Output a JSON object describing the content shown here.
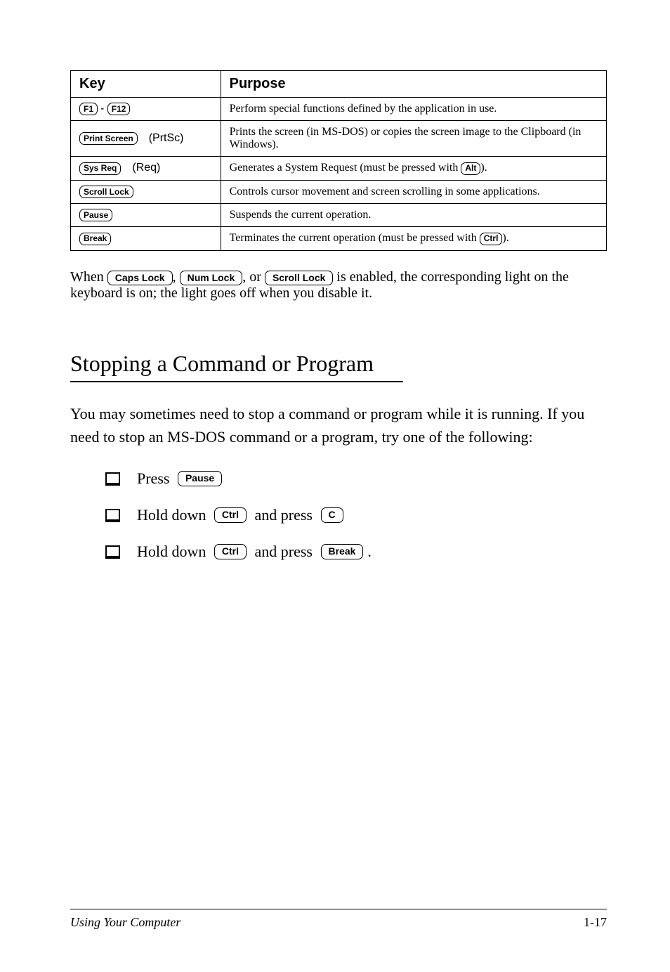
{
  "table": {
    "headers": {
      "key": "Key",
      "purpose": "Purpose"
    },
    "rows": [
      {
        "key_caps": [
          "F1",
          "F12"
        ],
        "key_sep": " - ",
        "key_extra": "",
        "desc": "Perform special functions defined by the application in use."
      },
      {
        "key_caps": [
          "Print Screen"
        ],
        "key_sep": "",
        "key_extra_tail": "(PrtSc)",
        "desc": "Prints the screen (in MS-DOS) or copies the screen image to the Clipboard (in Windows)."
      },
      {
        "key_caps": [
          "Sys Req"
        ],
        "key_sep": "",
        "key_extra_tail": "(Req)",
        "desc_pre": "Generates a System Request (must be pressed with ",
        "desc_cap": "Alt",
        "desc_post": ")."
      },
      {
        "key_caps": [
          "Scroll Lock"
        ],
        "desc": "Controls cursor movement and screen scrolling in some applications."
      },
      {
        "key_caps": [
          "Pause"
        ],
        "desc": "Suspends the current operation."
      },
      {
        "key_caps": [
          "Break"
        ],
        "desc_pre": "Terminates the current operation (must be pressed with ",
        "desc_cap": "Ctrl",
        "desc_post": ")."
      }
    ]
  },
  "note": {
    "pre": "When ",
    "caps": [
      "Caps Lock",
      "Num Lock",
      "Scroll Lock"
    ],
    "mid1": ", ",
    "mid2": ", or ",
    "post": " is enabled, the corresponding light on the keyboard is on; the light goes off when you disable it."
  },
  "section": {
    "title": "Stopping a Command or Program",
    "body": "You may sometimes need to stop a command or program while it is running. If you need to stop an MS-DOS command or a program, try one of the following:",
    "bullets": [
      {
        "pre": "Press ",
        "cap": "Pause",
        "post": ""
      },
      {
        "pre": "Hold down ",
        "cap": "Ctrl",
        "mid": " and press ",
        "cap2": "C",
        "post": ""
      },
      {
        "pre": "Hold down ",
        "cap": "Ctrl",
        "mid": " and press ",
        "cap2": "Break",
        "post": "."
      }
    ]
  },
  "footer": {
    "left": "Using Your Computer",
    "right": "1-17"
  }
}
